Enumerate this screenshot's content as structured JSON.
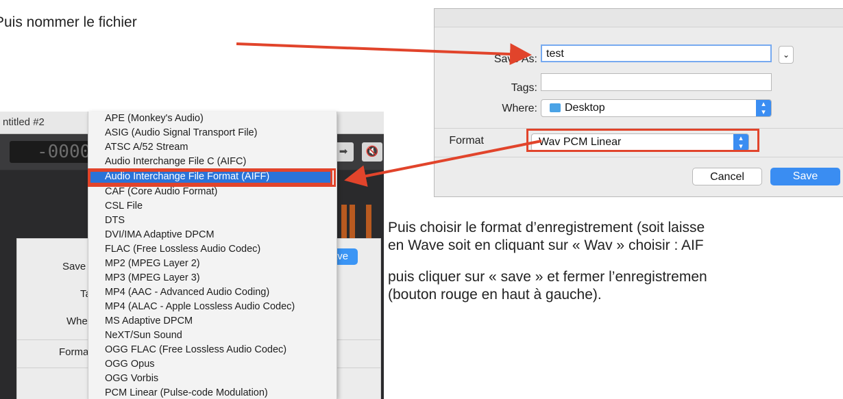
{
  "instructions": {
    "top_left": "Puis nommer le fichier",
    "para1_line1": "Puis choisir le format d’enregistrement  (soit laisse",
    "para1_line2": "en Wave soit en cliquant sur « Wav » choisir : AIF",
    "para2_line1": "puis cliquer sur « save » et fermer l’enregistremen",
    "para2_line2": "(bouton rouge en haut à gauche)."
  },
  "left_window": {
    "title": "ntitled #2",
    "lcd": "-0000:",
    "dialog_labels": {
      "save": "Save",
      "tags": "Ta",
      "where": "Whe",
      "format": "Forma"
    },
    "save_button": "Save"
  },
  "format_menu": {
    "items": [
      "APE (Monkey's Audio)",
      "ASIG (Audio Signal Transport File)",
      "ATSC A/52 Stream",
      "Audio Interchange File C (AIFC)",
      "Audio Interchange File Format (AIFF)",
      "CAF (Core Audio Format)",
      "CSL File",
      "DTS",
      "DVI/IMA Adaptive DPCM",
      "FLAC (Free Lossless Audio Codec)",
      "MP2 (MPEG Layer 2)",
      "MP3 (MPEG Layer 3)",
      "MP4 (AAC - Advanced Audio Coding)",
      "MP4 (ALAC - Apple Lossless Audio Codec)",
      "MS Adaptive DPCM",
      "NeXT/Sun Sound",
      "OGG FLAC (Free Lossless Audio Codec)",
      "OGG Opus",
      "OGG Vorbis",
      "PCM Linear (Pulse-code Modulation)"
    ],
    "selected": "Audio Interchange File Format (AIFF)"
  },
  "save_dialog": {
    "save_as_label": "Save As:",
    "save_as_value": "test",
    "tags_label": "Tags:",
    "where_label": "Where:",
    "where_value": "Desktop",
    "format_label": "Format",
    "format_value": "Wav PCM Linear",
    "cancel_button": "Cancel",
    "save_button": "Save"
  },
  "colors": {
    "annotation_red": "#e1442b",
    "accent_blue": "#3a8df2",
    "selection_blue": "#2a73d9"
  }
}
